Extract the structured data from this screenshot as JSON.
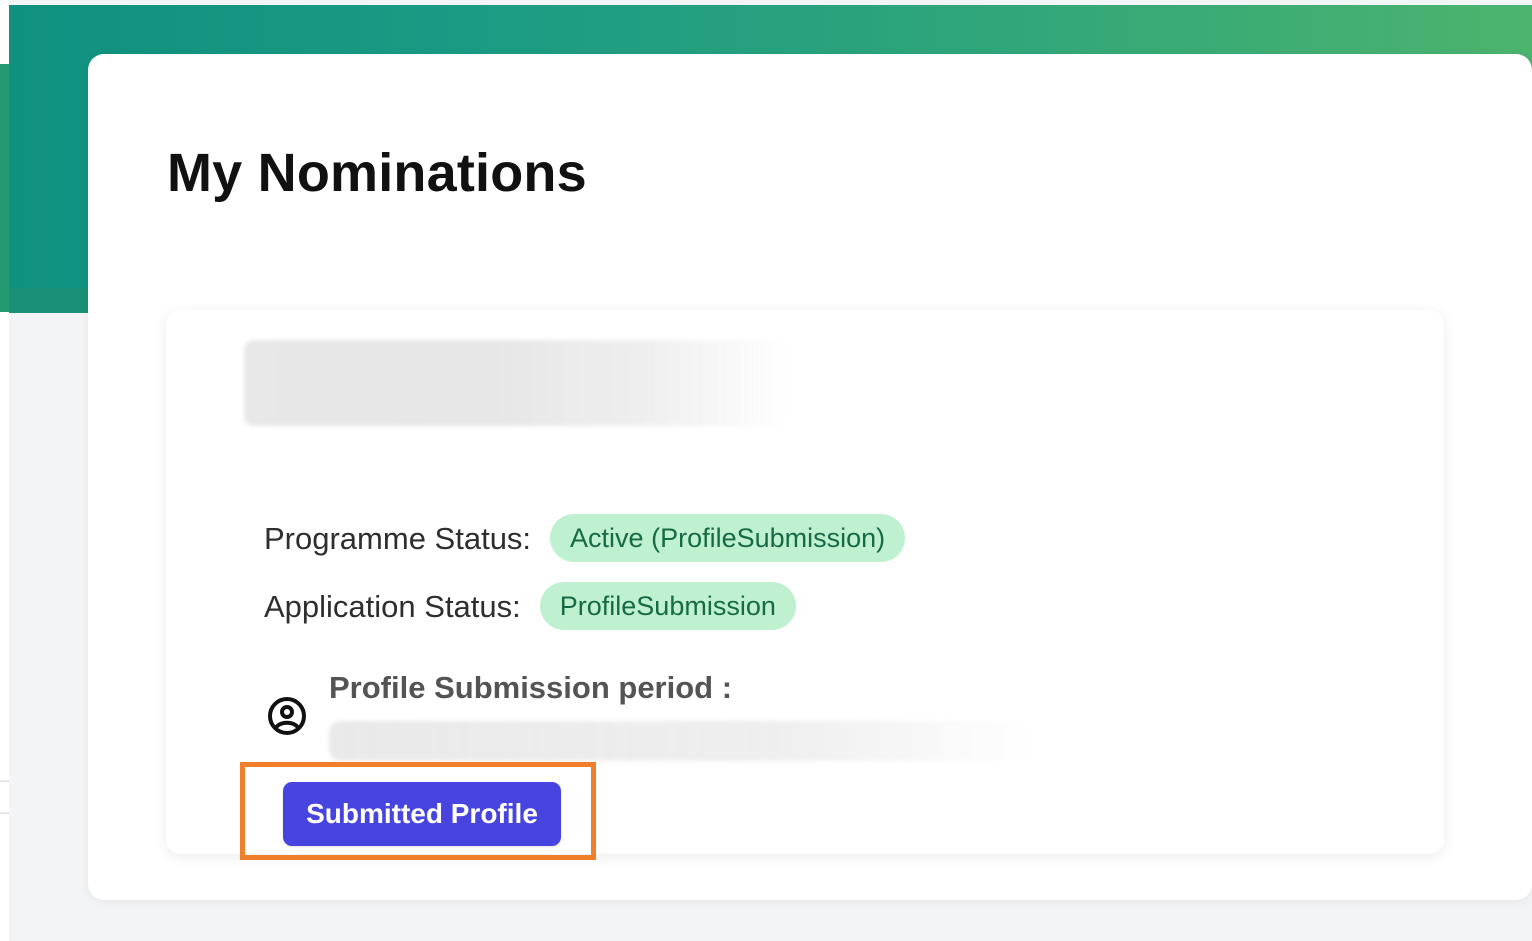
{
  "page": {
    "title": "My Nominations"
  },
  "nomination": {
    "programme_status_label": "Programme Status:",
    "programme_status_value": "Active (ProfileSubmission)",
    "application_status_label": "Application Status:",
    "application_status_value": "ProfileSubmission",
    "period_label": "Profile Submission period :",
    "icon_name": "user-circle-icon",
    "action_label": "Submitted Profile"
  },
  "colors": {
    "header_gradient_start": "#0f917f",
    "header_gradient_end": "#4cb46d",
    "badge_background": "#bff0cf",
    "badge_text": "#166b46",
    "button_background": "#4744e0",
    "highlight_border": "#f07f2c"
  }
}
